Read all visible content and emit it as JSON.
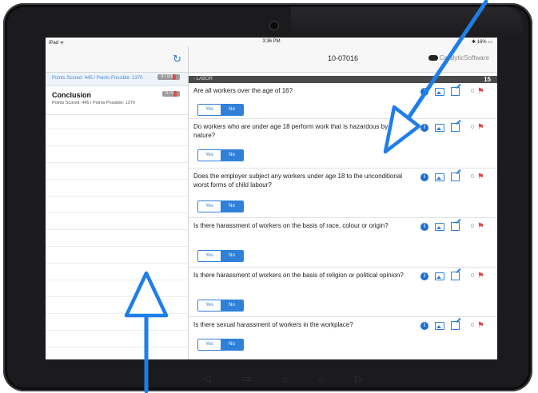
{
  "statusbar": {
    "left": "iPad ᯤ",
    "time": "3:36 PM",
    "battery": "✱ 16% ▭"
  },
  "sidebar": {
    "section_label": "Points Scored: 445 / Points Possible: 1370",
    "section_badge": "0 / 116",
    "conclusion": {
      "title": "Conclusion",
      "subtitle": "Points Scored: 445 / Points Possible: 1370",
      "badge": "0 / 0"
    }
  },
  "header": {
    "title": "10-07016",
    "brand": "CatalyticSoftware"
  },
  "category": {
    "label": "- LABOR",
    "count": "15"
  },
  "icons": {
    "refresh": "refresh-icon",
    "info": "info-icon",
    "image": "image-icon",
    "note": "edit-note-icon",
    "flag": "flag-icon"
  },
  "colors": {
    "accent": "#2f80d8",
    "flag": "#e24a4a",
    "category_bar": "#4a4a4a"
  },
  "questions": [
    {
      "text": "Are all workers over the age of 16?",
      "score": "0",
      "yes": "Yes",
      "no": "No",
      "selected": "No"
    },
    {
      "text": "Do workers who are under age 18 perform work that is hazardous by nature?",
      "score": "0",
      "yes": "Yes",
      "no": "No",
      "selected": "No"
    },
    {
      "text": "Does the employer subject any workers under age 18 to the unconditional worst forms of child labour?",
      "score": "0",
      "yes": "Yes",
      "no": "No",
      "selected": "No"
    },
    {
      "text": "Is there harassment of workers on the basis of race, colour or origin?",
      "score": "0",
      "yes": "Yes",
      "no": "No",
      "selected": "No"
    },
    {
      "text": "Is there harassment of workers on the basis of religion or political opinion?",
      "score": "0",
      "yes": "Yes",
      "no": "No",
      "selected": "No"
    },
    {
      "text": "Is there sexual harassment of workers in the workplace?",
      "score": "0",
      "yes": "Yes",
      "no": "No",
      "selected": "No"
    }
  ]
}
